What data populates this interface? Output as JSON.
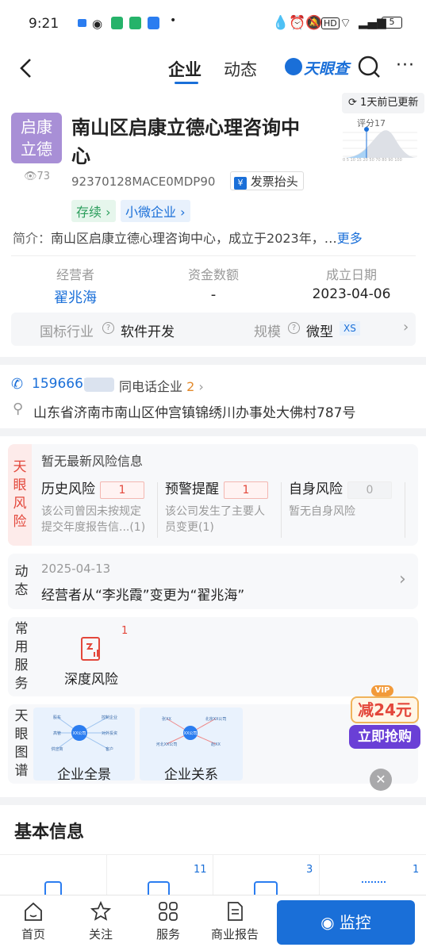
{
  "status": {
    "time": "9:21",
    "battery": "5"
  },
  "nav": {
    "tab_company": "企业",
    "tab_news": "动态",
    "brand": "天眼查"
  },
  "company": {
    "logo_line1": "启康",
    "logo_line2": "立德",
    "views": "73",
    "name_line1": "南山区启康立德心理咨询中",
    "name_line2": "心",
    "credit_code": "92370128MACE0MDP90",
    "invoice_label": "发票抬头",
    "status_tag": "存续",
    "size_tag": "小微企业",
    "update_label": "1天前已更新",
    "score_label": "评分17",
    "score_axis": "0 5 10 15 20 50 70 80 90 100",
    "intro_label": "简介：",
    "intro_text": "南山区启康立德心理咨询中心，成立于2023年，…",
    "more_label": "更多"
  },
  "facts": {
    "operator_label": "经营者",
    "operator_value": "翟兆海",
    "capital_label": "资金数额",
    "capital_value": "-",
    "founded_label": "成立日期",
    "founded_value": "2023-04-06",
    "industry_label": "国标行业",
    "industry_value": "软件开发",
    "scale_label": "规模",
    "scale_value": "微型",
    "scale_badge": "XS"
  },
  "contact": {
    "phone": "1596661",
    "same_phone_label": "同电话企业",
    "same_phone_count": "2",
    "address": "山东省济南市南山区仲宫镇锦绣川办事处大佛村787号"
  },
  "risk": {
    "side_label": [
      "天",
      "眼",
      "风",
      "险"
    ],
    "header": "暂无最新风险信息",
    "items": [
      {
        "title": "历史风险",
        "count": "1",
        "desc1": "该公司曾因未按规定",
        "desc2": "提交年度报告信...(1)"
      },
      {
        "title": "预警提醒",
        "count": "1",
        "desc1": "该公司发生了主要人",
        "desc2": "员变更(1)"
      },
      {
        "title": "自身风险",
        "count": "0",
        "desc1": "暂无自身风险",
        "desc2": ""
      }
    ]
  },
  "dynamic": {
    "side_label": [
      "动",
      "态"
    ],
    "date": "2025-04-13",
    "text": "经营者从“李兆霞”变更为“翟兆海”"
  },
  "services": {
    "side_label": [
      "常",
      "用",
      "服",
      "务"
    ],
    "item_label": "深度风险",
    "item_count": "1"
  },
  "graph": {
    "side_label": [
      "天",
      "眼",
      "图",
      "谱"
    ],
    "items": [
      "企业全景",
      "企业关系"
    ],
    "mini1": [
      "股东",
      "控制企业",
      "高管",
      "XX公司",
      "对外投资",
      "供应商",
      "客户"
    ],
    "mini2": [
      "张XX",
      "北京XX公司",
      "XX公司",
      "河北XX公司",
      "赵XX"
    ]
  },
  "promo": {
    "vip": "VIP",
    "discount": "减24元",
    "cta": "立即抢购"
  },
  "basic": {
    "title": "基本信息",
    "counts": [
      "11",
      "3",
      "1"
    ]
  },
  "tabbar": {
    "home": "首页",
    "follow": "关注",
    "service": "服务",
    "report": "商业报告",
    "monitor": "监控"
  },
  "colors": {
    "accent": "#1a6fd8",
    "logo_bg": "#a88fd6",
    "risk_red": "#e3473b",
    "green": "#2a9d5b"
  }
}
